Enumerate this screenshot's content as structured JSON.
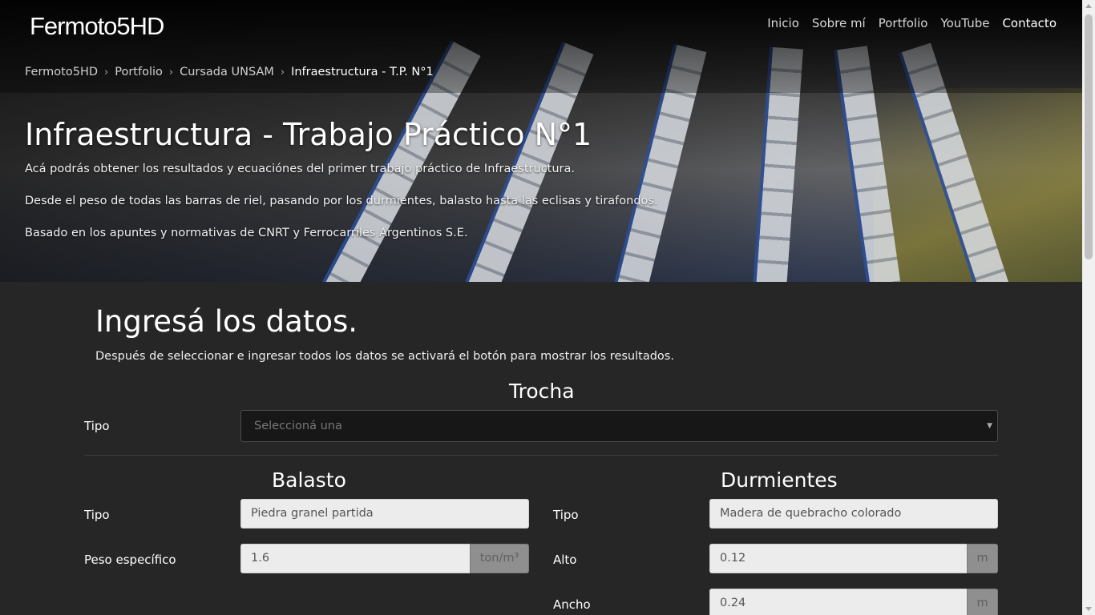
{
  "header": {
    "brand": "Fermoto5HD",
    "nav": [
      {
        "label": "Inicio"
      },
      {
        "label": "Sobre mí"
      },
      {
        "label": "Portfolio"
      },
      {
        "label": "YouTube"
      },
      {
        "label": "Contacto"
      }
    ]
  },
  "breadcrumb": {
    "items": [
      "Fermoto5HD",
      "Portfolio",
      "Cursada UNSAM",
      "Infraestructura - T.P. N°1"
    ],
    "separator": "›"
  },
  "hero": {
    "title": "Infraestructura - Trabajo Práctico N°1",
    "paragraphs": [
      "Acá podrás obtener los resultados y ecuaciónes del primer trabajo práctico de Infraestructura.",
      "Desde el peso de todas las barras de riel, pasando por los durmientes, balasto hasta las eclisas y tirafondos.",
      "Basado en los apuntes y normativas de CNRT y Ferrocarriles Argentinos S.E."
    ]
  },
  "form": {
    "title": "Ingresá los datos.",
    "subtitle": "Después de seleccionar e ingresar todos los datos se activará el botón para mostrar los resultados.",
    "trocha": {
      "heading": "Trocha",
      "tipo_label": "Tipo",
      "tipo_placeholder": "Seleccioná una",
      "caret": "▼"
    },
    "balasto": {
      "heading": "Balasto",
      "tipo_label": "Tipo",
      "tipo_value": "Piedra granel partida",
      "peso_label": "Peso específico",
      "peso_value": "1.6",
      "peso_unit": "ton/m³"
    },
    "durmientes": {
      "heading": "Durmientes",
      "tipo_label": "Tipo",
      "tipo_value": "Madera de quebracho colorado",
      "alto_label": "Alto",
      "alto_value": "0.12",
      "alto_unit": "m",
      "ancho_label": "Ancho",
      "ancho_value": "0.24",
      "ancho_unit": "m"
    }
  }
}
